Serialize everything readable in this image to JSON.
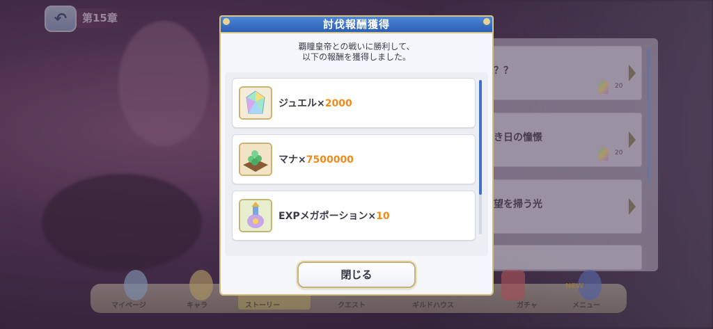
{
  "top": {
    "back_icon": "back-arrow-icon",
    "chapter_label": "第15章"
  },
  "background_list": {
    "items": [
      {
        "title": "？？",
        "count": "20"
      },
      {
        "title": "き日の憧憬",
        "count": "20"
      },
      {
        "title": "望を掃う光",
        "count": ""
      },
      {
        "title": "",
        "count": ""
      }
    ]
  },
  "bottom_nav": {
    "items": [
      "マイページ",
      "キャラ",
      "ストーリー",
      "クエスト",
      "ギルドハウス",
      "ガチャ",
      "メニュー"
    ],
    "new_badge": "NEW"
  },
  "modal": {
    "title": "討伐報酬獲得",
    "message_line1": "覇瞳皇帝との戦いに勝利して、",
    "message_line2": "以下の報酬を獲得しました。",
    "rewards": [
      {
        "name": "ジュエル×",
        "qty": "2000",
        "icon": "jewel-icon"
      },
      {
        "name": "マナ×",
        "qty": "7500000",
        "icon": "mana-icon"
      },
      {
        "name": "EXPメガポーション×",
        "qty": "10",
        "icon": "exp-potion-icon"
      }
    ],
    "close_label": "閉じる"
  },
  "colors": {
    "header_blue": "#2b5fb4",
    "qty_orange": "#ef8a17",
    "gold_border": "#c9b374"
  }
}
